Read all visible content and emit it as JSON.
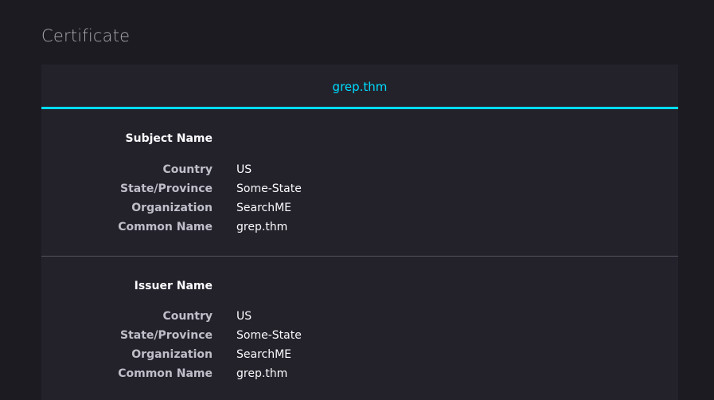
{
  "page": {
    "title": "Certificate"
  },
  "tabs": [
    {
      "label": "grep.thm"
    }
  ],
  "subject": {
    "heading": "Subject Name",
    "fields": [
      {
        "label": "Country",
        "value": "US"
      },
      {
        "label": "State/Province",
        "value": "Some-State"
      },
      {
        "label": "Organization",
        "value": "SearchME"
      },
      {
        "label": "Common Name",
        "value": "grep.thm"
      }
    ]
  },
  "issuer": {
    "heading": "Issuer Name",
    "fields": [
      {
        "label": "Country",
        "value": "US"
      },
      {
        "label": "State/Province",
        "value": "Some-State"
      },
      {
        "label": "Organization",
        "value": "SearchME"
      },
      {
        "label": "Common Name",
        "value": "grep.thm"
      }
    ]
  },
  "colors": {
    "background": "#1c1b22",
    "card": "#23222b",
    "accent": "#00ddff",
    "label": "#bfbfc9",
    "text": "#fbfbfe",
    "divider": "#52525e"
  }
}
